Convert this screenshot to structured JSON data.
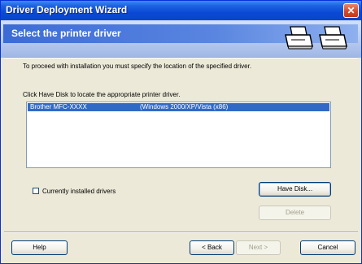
{
  "window": {
    "title": "Driver Deployment Wizard",
    "close_glyph": "✕"
  },
  "header": {
    "title": "Select the printer driver",
    "icons": [
      "printer-icon",
      "printer-icon"
    ]
  },
  "body": {
    "instruction": "To proceed with installation you must specify the location of the specified driver.",
    "have_disk_hint": "Click Have Disk to locate the appropriate printer driver."
  },
  "driver_list": {
    "rows": [
      {
        "name": "Brother  MFC-XXXX",
        "platform": "(Windows 2000/XP/Vista (x86)",
        "selected": true
      }
    ]
  },
  "checkbox": {
    "label": "Currently installed drivers",
    "checked": false
  },
  "buttons": {
    "have_disk": "Have Disk...",
    "delete": "Delete",
    "help": "Help",
    "back": "< Back",
    "next": "Next >",
    "cancel": "Cancel"
  },
  "colors": {
    "title_bar": "#0a49d6",
    "header_band": "#3b6bd6",
    "selection": "#316ac5",
    "dialog_bg": "#ece9d8"
  }
}
